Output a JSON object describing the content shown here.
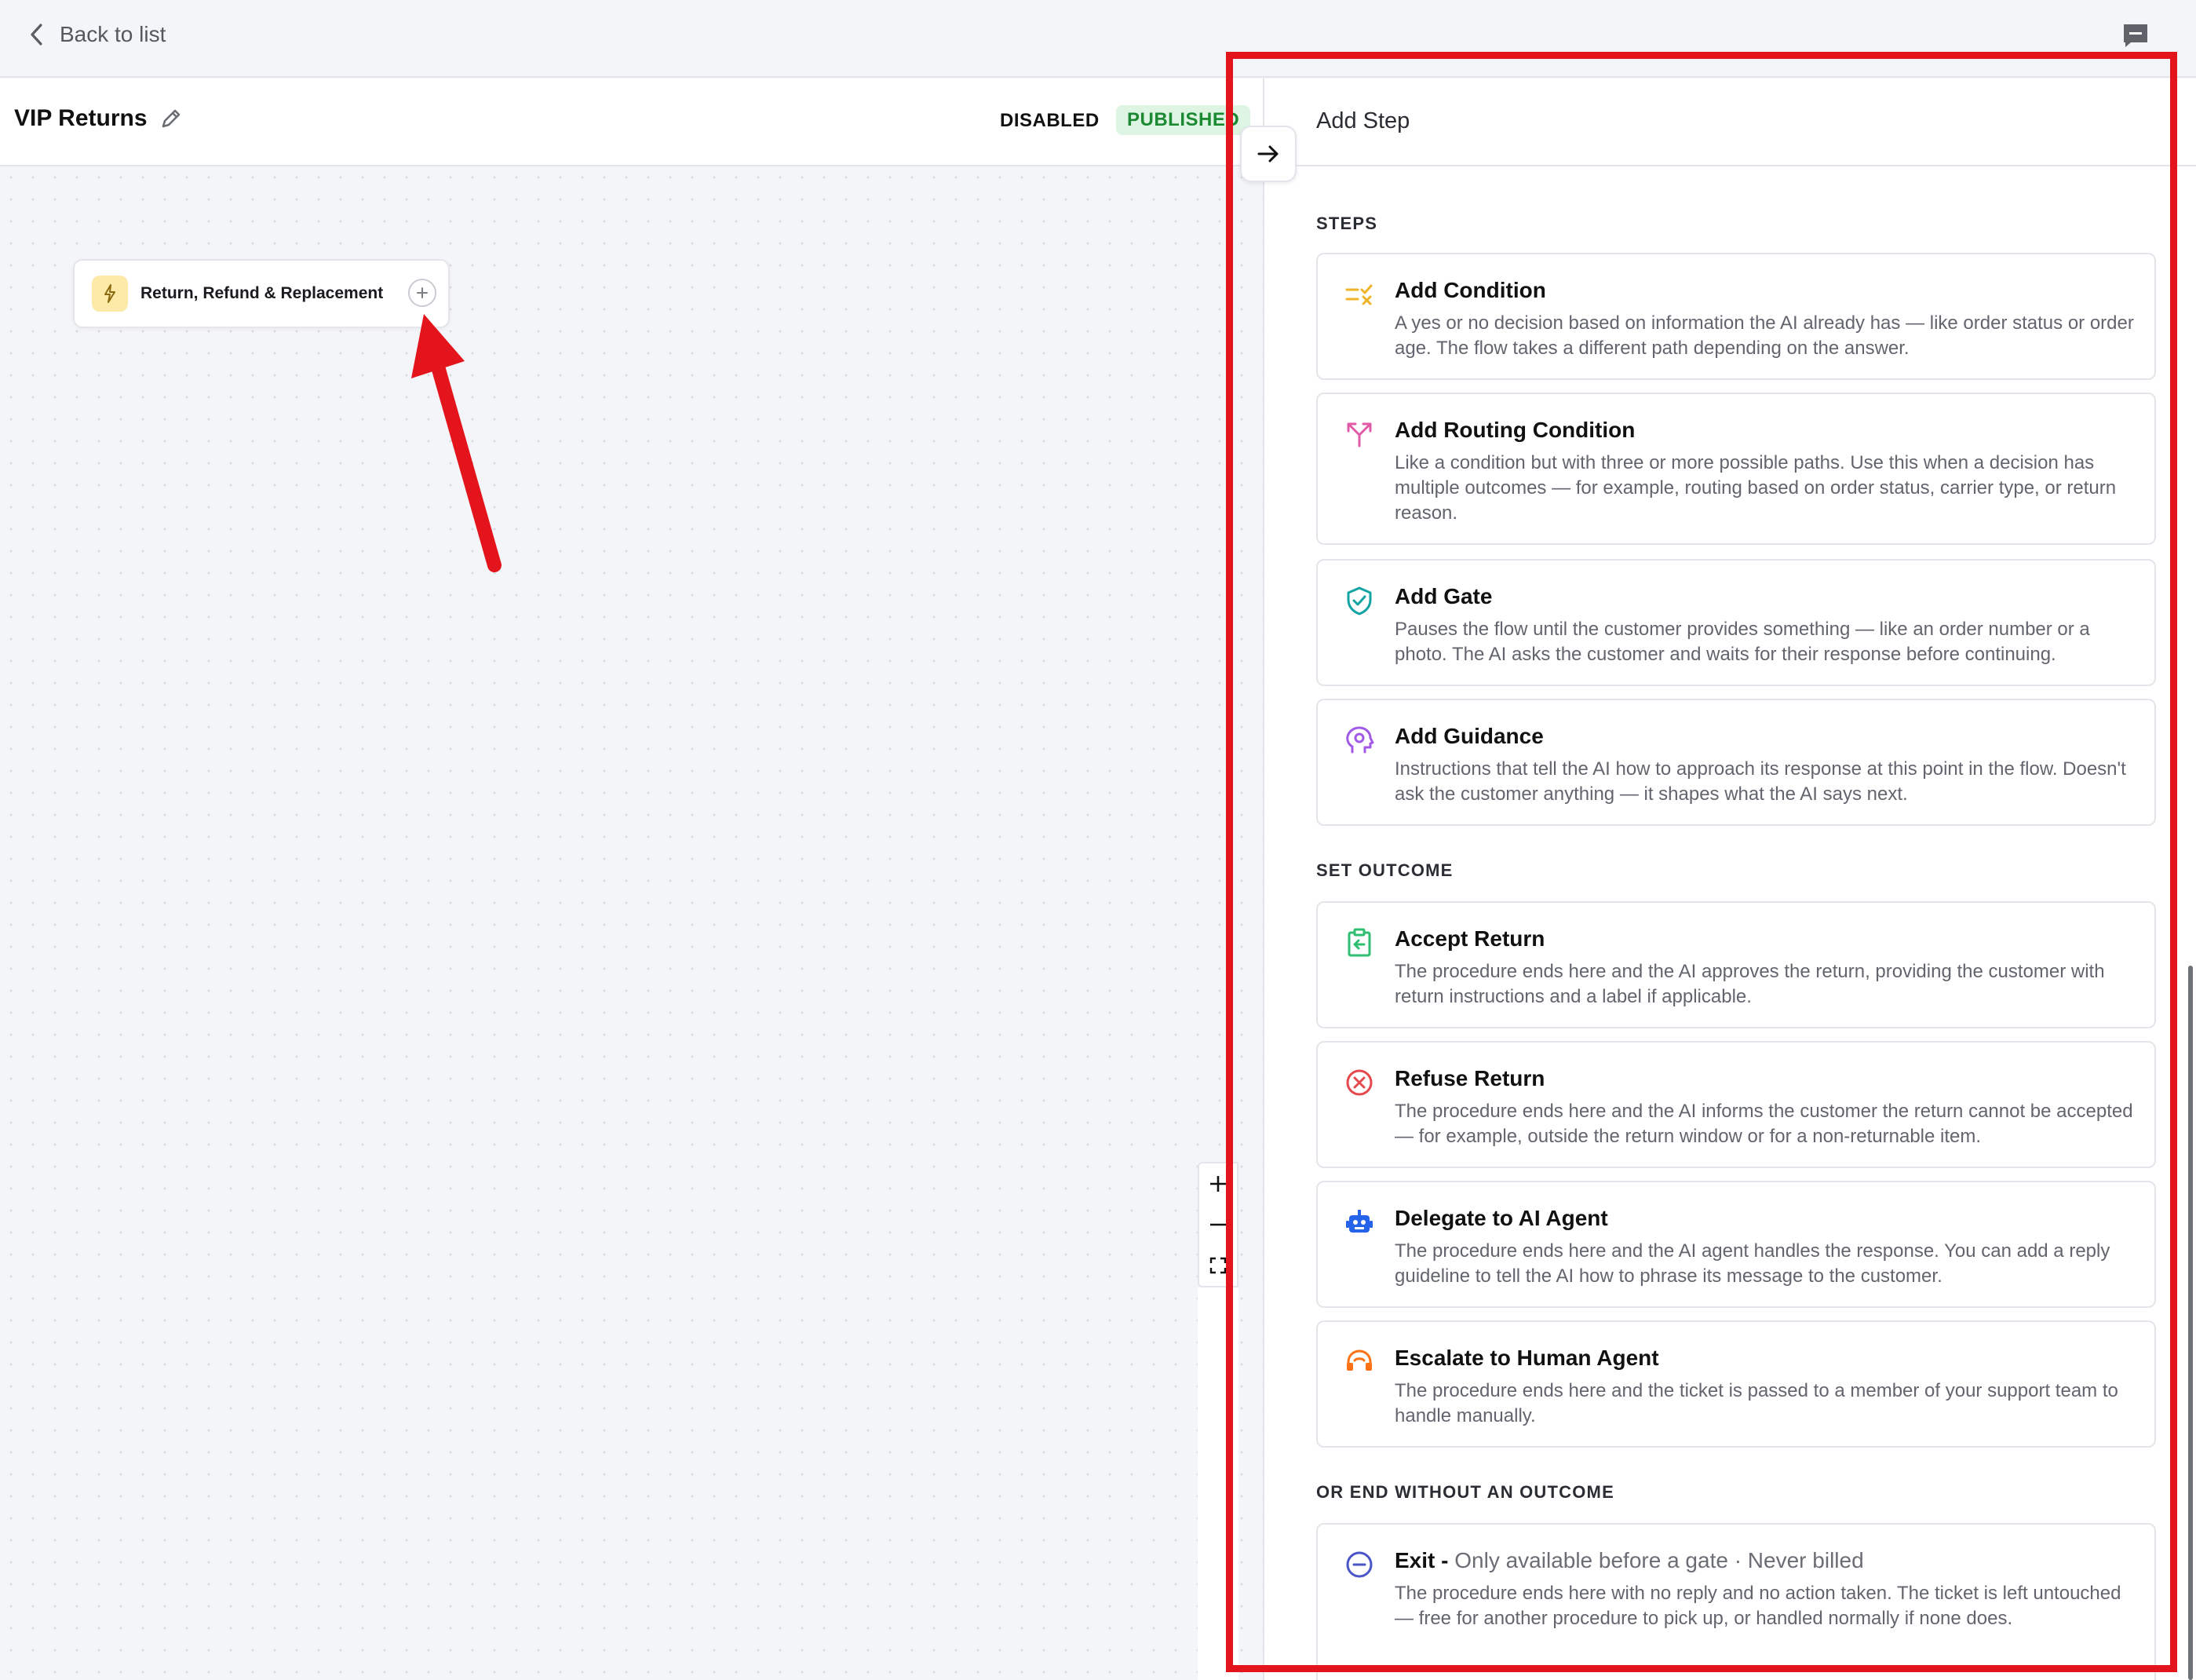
{
  "topbar": {
    "back_label": "Back to list"
  },
  "flow": {
    "title": "VIP Returns",
    "status_disabled": "DISABLED",
    "status_published": "PUBLISHED",
    "trigger_label": "Return, Refund & Replacement"
  },
  "panel": {
    "title": "Add Step",
    "sections": {
      "steps": "STEPS",
      "outcome": "SET OUTCOME",
      "end": "OR END WITHOUT AN OUTCOME"
    },
    "cards": {
      "condition": {
        "title": "Add Condition",
        "desc": "A yes or no decision based on information the AI already has — like order status or order age. The flow takes a different path depending on the answer."
      },
      "routing": {
        "title": "Add Routing Condition",
        "desc": "Like a condition but with three or more possible paths. Use this when a decision has multiple outcomes — for example, routing based on order status, carrier type, or return reason."
      },
      "gate": {
        "title": "Add Gate",
        "desc": "Pauses the flow until the customer provides something — like an order number or a photo. The AI asks the customer and waits for their response before continuing."
      },
      "guidance": {
        "title": "Add Guidance",
        "desc": "Instructions that tell the AI how to approach its response at this point in the flow. Doesn't ask the customer anything — it shapes what the AI says next."
      },
      "accept": {
        "title": "Accept Return",
        "desc": "The procedure ends here and the AI approves the return, providing the customer with return instructions and a label if applicable."
      },
      "refuse": {
        "title": "Refuse Return",
        "desc": "The procedure ends here and the AI informs the customer the return cannot be accepted — for example, outside the return window or for a non-returnable item."
      },
      "delegate": {
        "title": "Delegate to AI Agent",
        "desc": "The procedure ends here and the AI agent handles the response. You can add a reply guideline to tell the AI how to phrase its message to the customer."
      },
      "escalate": {
        "title": "Escalate to Human Agent",
        "desc": "The procedure ends here and the ticket is passed to a member of your support team to handle manually."
      },
      "exit": {
        "title": "Exit -",
        "subtitle": "Only available before a gate · Never billed",
        "desc": "The procedure ends here with no reply and no action taken. The ticket is left untouched — free for another procedure to pick up, or handled normally if none does."
      }
    }
  },
  "colors": {
    "accent_red": "#e4141c",
    "published_bg": "#dff5e3",
    "published_text": "#1c8a32",
    "condition_icon": "#f0b429",
    "routing_icon": "#e05aa8",
    "gate_icon": "#14a3a3",
    "guidance_icon": "#a259e6",
    "accept_icon": "#2fbf71",
    "refuse_icon": "#e5484d",
    "delegate_icon": "#2563eb",
    "escalate_icon": "#f97316",
    "exit_icon": "#4a55c7"
  }
}
